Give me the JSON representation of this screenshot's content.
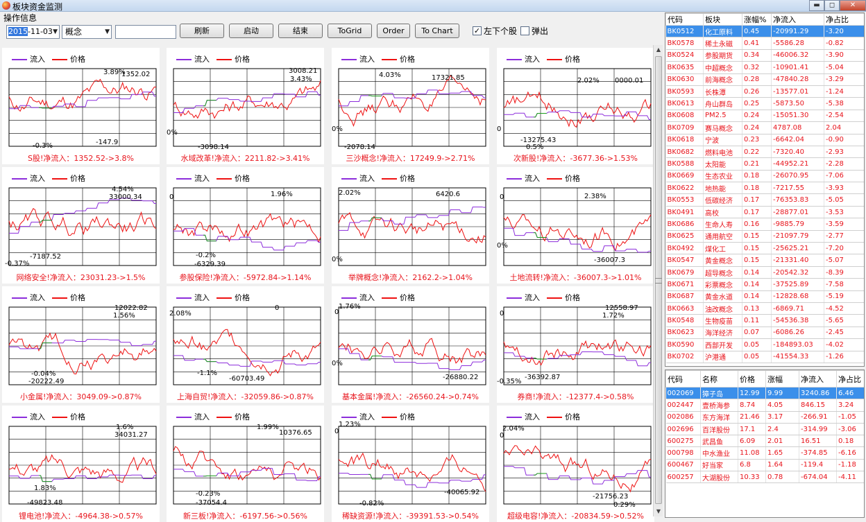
{
  "window": {
    "title": "板块资金监测"
  },
  "toolbar": {
    "ops_label": "操作信息",
    "date_value": "2015-11-03",
    "date_selected_part": "2015",
    "date_rest": "-11-03",
    "category_value": "概念",
    "buttons": {
      "refresh": "刷新",
      "start": "启动",
      "end": "结束",
      "togrid": "ToGrid",
      "order": "Order",
      "tochart": "To Chart"
    },
    "checkbox_left_lower": {
      "label": "左下个股",
      "checked": true
    },
    "checkbox_popup": {
      "label": "弹出",
      "checked": false
    }
  },
  "legend": {
    "inflow": "流入",
    "price": "价格"
  },
  "colors": {
    "inflow_line": "#8c2ddb",
    "price_line": "#ee1111",
    "negative_inflow": "#1a9a1a",
    "up_text": "#e8141c",
    "down_text": "#0a9a2c",
    "selection": "#3b8fea"
  },
  "chart_data": [
    {
      "type": "line",
      "caption": "S股!净流入：1352.52->3.8%",
      "annotations": [
        "3.89%",
        "1352.02",
        "-0.3%",
        "-147.9"
      ],
      "price_final_pct": 3.8,
      "inflow_final": 1352.52
    },
    {
      "type": "line",
      "caption": "水域改革!净流入：2211.82->3.41%",
      "annotations": [
        "3008.21",
        "3.43%",
        "0%",
        "-3098.14"
      ],
      "price_final_pct": 3.41,
      "inflow_final": 2211.82
    },
    {
      "type": "line",
      "caption": "三沙概念!净流入：17249.9->2.71%",
      "annotations": [
        "4.03%",
        "17321.85",
        "0%",
        "-2078.14"
      ],
      "price_final_pct": 2.71,
      "inflow_final": 17249.9
    },
    {
      "type": "line",
      "caption": "次新股!净流入：-3677.36->1.53%",
      "annotations": [
        "2.02%",
        "0000.01",
        "0",
        "-13275.43",
        "0.5%"
      ],
      "price_final_pct": 1.53,
      "inflow_final": -3677.36
    },
    {
      "type": "line",
      "caption": "网络安全!净流入：23031.23->1.5%",
      "annotations": [
        "4.54%",
        "33000.34",
        "-0.37%",
        "-7187.52"
      ],
      "price_final_pct": 1.5,
      "inflow_final": 23031.23
    },
    {
      "type": "line",
      "caption": "参股保险!净流入：-5972.84->1.14%",
      "annotations": [
        "1.96%",
        "0",
        "-0.2%",
        "-6329.39"
      ],
      "price_final_pct": 1.14,
      "inflow_final": -5972.84
    },
    {
      "type": "line",
      "caption": "举牌概念!净流入：2162.2->1.04%",
      "annotations": [
        "2.02%",
        "6420.6",
        "0%"
      ],
      "price_final_pct": 1.04,
      "inflow_final": 2162.2
    },
    {
      "type": "line",
      "caption": "土地流转!净流入：-36007.3->1.01%",
      "annotations": [
        "2.38%",
        "0",
        "0%",
        "-36007.3"
      ],
      "price_final_pct": 1.01,
      "inflow_final": -36007.3
    },
    {
      "type": "line",
      "caption": "小金属!净流入：3049.09->0.87%",
      "annotations": [
        "12022.82",
        "1.56%",
        "-0.04%",
        "-20222.49"
      ],
      "price_final_pct": 0.87,
      "inflow_final": 3049.09
    },
    {
      "type": "line",
      "caption": "上海自贸!净流入：-32059.86->0.87%",
      "annotations": [
        "0",
        "2.08%",
        "-1.1%",
        "-60703.49"
      ],
      "price_final_pct": 0.87,
      "inflow_final": -32059.86
    },
    {
      "type": "line",
      "caption": "基本金属!净流入：-26560.24->0.74%",
      "annotations": [
        "1.76%",
        "0",
        "0%",
        "-26880.22"
      ],
      "price_final_pct": 0.74,
      "inflow_final": -26560.24
    },
    {
      "type": "line",
      "caption": "券商!净流入：-12377.4->0.58%",
      "annotations": [
        "12558.97",
        "1.72%",
        "0",
        "-0.35%",
        "-36392.87"
      ],
      "price_final_pct": 0.58,
      "inflow_final": -12377.4
    },
    {
      "type": "line",
      "caption": "锂电池!净流入：-4964.38->0.57%",
      "annotations": [
        "1.6%",
        "34031.27",
        "1.83%",
        "-49823.48"
      ],
      "price_final_pct": 0.57,
      "inflow_final": -4964.38
    },
    {
      "type": "line",
      "caption": "新三板!净流入：-6197.56->0.56%",
      "annotations": [
        "1.99%",
        "10376.65",
        "-0.23%",
        "-37054.4"
      ],
      "price_final_pct": 0.56,
      "inflow_final": -6197.56
    },
    {
      "type": "line",
      "caption": "稀缺资源!净流入：-39391.53->0.54%",
      "annotations": [
        "1.23%",
        "0",
        "-0.82%",
        "-40065.92"
      ],
      "price_final_pct": 0.54,
      "inflow_final": -39391.53
    },
    {
      "type": "line",
      "caption": "超级电容!净流入：-20834.59->0.52%",
      "annotations": [
        "2.04%",
        "0",
        "-21756.23",
        "0.29%"
      ],
      "price_final_pct": 0.52,
      "inflow_final": -20834.59
    }
  ],
  "sector_table": {
    "headers": [
      "代码",
      "板块",
      "涨幅%",
      "净流入",
      "净占比"
    ],
    "rows": [
      [
        "BK0512",
        "化工原料",
        "0.45",
        "-20991.29",
        "-3.20"
      ],
      [
        "BK0578",
        "稀土永磁",
        "0.41",
        "-5586.28",
        "-0.82"
      ],
      [
        "BK0524",
        "参股期货",
        "0.34",
        "-46006.32",
        "-3.90"
      ],
      [
        "BK0635",
        "中超概念",
        "0.32",
        "-10901.41",
        "-5.04"
      ],
      [
        "BK0630",
        "前海概念",
        "0.28",
        "-47840.28",
        "-3.29"
      ],
      [
        "BK0593",
        "长株潭",
        "0.26",
        "-13577.01",
        "-1.24"
      ],
      [
        "BK0613",
        "舟山群岛",
        "0.25",
        "-5873.50",
        "-5.38"
      ],
      [
        "BK0608",
        "PM2.5",
        "0.24",
        "-15051.30",
        "-2.54"
      ],
      [
        "BK0709",
        "赛马概念",
        "0.24",
        "4787.08",
        "2.04"
      ],
      [
        "BK0618",
        "宁波",
        "0.23",
        "-6642.04",
        "-0.90"
      ],
      [
        "BK0682",
        "燃料电池",
        "0.22",
        "-7320.40",
        "-2.93"
      ],
      [
        "BK0588",
        "太阳能",
        "0.21",
        "-44952.21",
        "-2.28"
      ],
      [
        "BK0669",
        "生态农业",
        "0.18",
        "-26070.95",
        "-7.06"
      ],
      [
        "BK0622",
        "地热能",
        "0.18",
        "-7217.55",
        "-3.93"
      ],
      [
        "BK0553",
        "低碳经济",
        "0.17",
        "-76353.83",
        "-5.05"
      ],
      [
        "BK0491",
        "高校",
        "0.17",
        "-28877.01",
        "-3.53"
      ],
      [
        "BK0686",
        "生命人寿",
        "0.16",
        "-9885.79",
        "-3.59"
      ],
      [
        "BK0625",
        "通用航空",
        "0.15",
        "-21097.79",
        "-2.77"
      ],
      [
        "BK0492",
        "煤化工",
        "0.15",
        "-25625.21",
        "-7.20"
      ],
      [
        "BK0547",
        "黄金概念",
        "0.15",
        "-21331.40",
        "-5.07"
      ],
      [
        "BK0679",
        "超导概念",
        "0.14",
        "-20542.32",
        "-8.39"
      ],
      [
        "BK0671",
        "彩票概念",
        "0.14",
        "-37525.89",
        "-7.58"
      ],
      [
        "BK0687",
        "黄金水道",
        "0.14",
        "-12828.68",
        "-5.19"
      ],
      [
        "BK0663",
        "油改概念",
        "0.13",
        "-6869.71",
        "-4.52"
      ],
      [
        "BK0548",
        "生物疫苗",
        "0.11",
        "-54536.38",
        "-5.65"
      ],
      [
        "BK0623",
        "海洋经济",
        "0.07",
        "-6086.26",
        "-2.45"
      ],
      [
        "BK0590",
        "西部开发",
        "0.05",
        "-184893.03",
        "-4.02"
      ],
      [
        "BK0702",
        "沪港通",
        "0.05",
        "-41554.33",
        "-1.26"
      ]
    ]
  },
  "stock_table": {
    "headers": [
      "代码",
      "名称",
      "价格",
      "涨幅",
      "净流入",
      "净占比"
    ],
    "rows": [
      [
        "002069",
        "獐子岛",
        "12.99",
        "9.99",
        "3240.86",
        "6.46"
      ],
      [
        "002447",
        "壹桥海参",
        "8.74",
        "4.05",
        "846.15",
        "3.24"
      ],
      [
        "002086",
        "东方海洋",
        "21.46",
        "3.17",
        "-266.91",
        "-1.05"
      ],
      [
        "002696",
        "百洋股份",
        "17.1",
        "2.4",
        "-314.99",
        "-3.06"
      ],
      [
        "600275",
        "武昌鱼",
        "6.09",
        "2.01",
        "16.51",
        "0.18"
      ],
      [
        "000798",
        "中水渔业",
        "11.08",
        "1.65",
        "-374.85",
        "-6.16"
      ],
      [
        "600467",
        "好当家",
        "6.8",
        "1.64",
        "-119.4",
        "-1.18"
      ],
      [
        "600257",
        "大湖股份",
        "10.33",
        "0.78",
        "-674.04",
        "-4.11"
      ]
    ]
  }
}
